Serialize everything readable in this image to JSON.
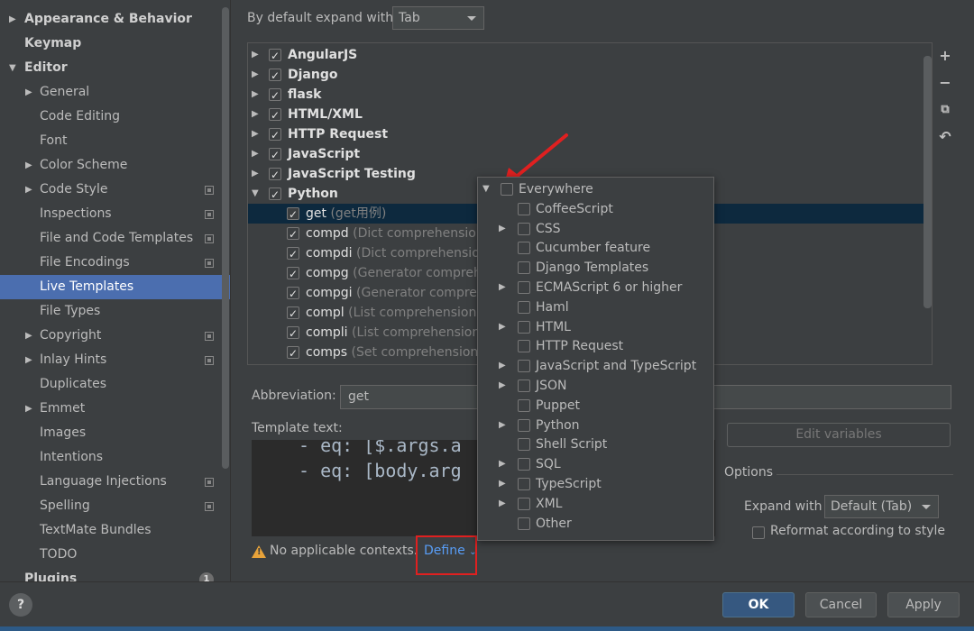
{
  "sidebar": {
    "items": [
      {
        "label": "Appearance & Behavior",
        "arrow": "▶",
        "indent": 0,
        "bold": true,
        "copy": false
      },
      {
        "label": "Keymap",
        "arrow": "",
        "indent": 0,
        "bold": true,
        "copy": false
      },
      {
        "label": "Editor",
        "arrow": "▼",
        "indent": 0,
        "bold": true,
        "copy": false
      },
      {
        "label": "General",
        "arrow": "▶",
        "indent": 1,
        "bold": false,
        "copy": false
      },
      {
        "label": "Code Editing",
        "arrow": "",
        "indent": 1,
        "bold": false,
        "copy": false
      },
      {
        "label": "Font",
        "arrow": "",
        "indent": 1,
        "bold": false,
        "copy": false
      },
      {
        "label": "Color Scheme",
        "arrow": "▶",
        "indent": 1,
        "bold": false,
        "copy": false
      },
      {
        "label": "Code Style",
        "arrow": "▶",
        "indent": 1,
        "bold": false,
        "copy": true
      },
      {
        "label": "Inspections",
        "arrow": "",
        "indent": 1,
        "bold": false,
        "copy": true
      },
      {
        "label": "File and Code Templates",
        "arrow": "",
        "indent": 1,
        "bold": false,
        "copy": true
      },
      {
        "label": "File Encodings",
        "arrow": "",
        "indent": 1,
        "bold": false,
        "copy": true
      },
      {
        "label": "Live Templates",
        "arrow": "",
        "indent": 1,
        "bold": false,
        "copy": false,
        "selected": true
      },
      {
        "label": "File Types",
        "arrow": "",
        "indent": 1,
        "bold": false,
        "copy": false
      },
      {
        "label": "Copyright",
        "arrow": "▶",
        "indent": 1,
        "bold": false,
        "copy": true
      },
      {
        "label": "Inlay Hints",
        "arrow": "▶",
        "indent": 1,
        "bold": false,
        "copy": true
      },
      {
        "label": "Duplicates",
        "arrow": "",
        "indent": 1,
        "bold": false,
        "copy": false
      },
      {
        "label": "Emmet",
        "arrow": "▶",
        "indent": 1,
        "bold": false,
        "copy": false
      },
      {
        "label": "Images",
        "arrow": "",
        "indent": 1,
        "bold": false,
        "copy": false
      },
      {
        "label": "Intentions",
        "arrow": "",
        "indent": 1,
        "bold": false,
        "copy": false
      },
      {
        "label": "Language Injections",
        "arrow": "",
        "indent": 1,
        "bold": false,
        "copy": true
      },
      {
        "label": "Spelling",
        "arrow": "",
        "indent": 1,
        "bold": false,
        "copy": true
      },
      {
        "label": "TextMate Bundles",
        "arrow": "",
        "indent": 1,
        "bold": false,
        "copy": false
      },
      {
        "label": "TODO",
        "arrow": "",
        "indent": 1,
        "bold": false,
        "copy": false
      },
      {
        "label": "Plugins",
        "arrow": "",
        "indent": 0,
        "bold": true,
        "copy": false,
        "badge": "1"
      }
    ]
  },
  "expand": {
    "label": "By default expand with",
    "value": "Tab"
  },
  "template_groups": [
    {
      "name": "AngularJS",
      "checked": true,
      "expanded": false
    },
    {
      "name": "Django",
      "checked": true,
      "expanded": false
    },
    {
      "name": "flask",
      "checked": true,
      "expanded": false
    },
    {
      "name": "HTML/XML",
      "checked": true,
      "expanded": false
    },
    {
      "name": "HTTP Request",
      "checked": true,
      "expanded": false
    },
    {
      "name": "JavaScript",
      "checked": true,
      "expanded": false
    },
    {
      "name": "JavaScript Testing",
      "checked": true,
      "expanded": false
    },
    {
      "name": "Python",
      "checked": true,
      "expanded": true
    }
  ],
  "python_templates": [
    {
      "name": "get",
      "desc": "(get用例)",
      "selected": true
    },
    {
      "name": "compd",
      "desc": "(Dict comprehension)"
    },
    {
      "name": "compdi",
      "desc": "(Dict comprehension"
    },
    {
      "name": "compg",
      "desc": "(Generator comprehe"
    },
    {
      "name": "compgi",
      "desc": "(Generator comprehe"
    },
    {
      "name": "compl",
      "desc": "(List comprehension)"
    },
    {
      "name": "compli",
      "desc": "(List comprehension w"
    },
    {
      "name": "comps",
      "desc": "(Set comprehension)"
    }
  ],
  "tools": {
    "add": "+",
    "remove": "−",
    "copy": "⧉",
    "revert": "↶"
  },
  "abbreviation": {
    "label": "Abbreviation:",
    "value": "get"
  },
  "template_text": {
    "label": "Template text:",
    "lines": [
      "- eq: [$.args.a",
      "- eq: [body.arg"
    ]
  },
  "edit_variables": "Edit variables",
  "options": {
    "label": "Options",
    "expand_with_label": "Expand with",
    "expand_with_value": "Default (Tab)",
    "reformat_label": "Reformat according to style"
  },
  "warning": {
    "text": "No applicable contexts.",
    "define": "Define"
  },
  "contexts": [
    {
      "label": "Everywhere",
      "arrow": "▼",
      "level": 0
    },
    {
      "label": "CoffeeScript",
      "arrow": "",
      "level": 1
    },
    {
      "label": "CSS",
      "arrow": "▶",
      "level": 1
    },
    {
      "label": "Cucumber feature",
      "arrow": "",
      "level": 1
    },
    {
      "label": "Django Templates",
      "arrow": "",
      "level": 1
    },
    {
      "label": "ECMAScript 6 or higher",
      "arrow": "▶",
      "level": 1
    },
    {
      "label": "Haml",
      "arrow": "",
      "level": 1
    },
    {
      "label": "HTML",
      "arrow": "▶",
      "level": 1
    },
    {
      "label": "HTTP Request",
      "arrow": "",
      "level": 1
    },
    {
      "label": "JavaScript and TypeScript",
      "arrow": "▶",
      "level": 1
    },
    {
      "label": "JSON",
      "arrow": "▶",
      "level": 1
    },
    {
      "label": "Puppet",
      "arrow": "",
      "level": 1
    },
    {
      "label": "Python",
      "arrow": "▶",
      "level": 1
    },
    {
      "label": "Shell Script",
      "arrow": "",
      "level": 1
    },
    {
      "label": "SQL",
      "arrow": "▶",
      "level": 1
    },
    {
      "label": "TypeScript",
      "arrow": "▶",
      "level": 1
    },
    {
      "label": "XML",
      "arrow": "▶",
      "level": 1
    },
    {
      "label": "Other",
      "arrow": "",
      "level": 1
    }
  ],
  "footer": {
    "help": "?",
    "ok": "OK",
    "cancel": "Cancel",
    "apply": "Apply"
  },
  "colors": {
    "accent": "#4b6eaf",
    "ok": "#365880",
    "link": "#589df6",
    "highlight": "#e02020",
    "warning": "#e8a33a"
  }
}
